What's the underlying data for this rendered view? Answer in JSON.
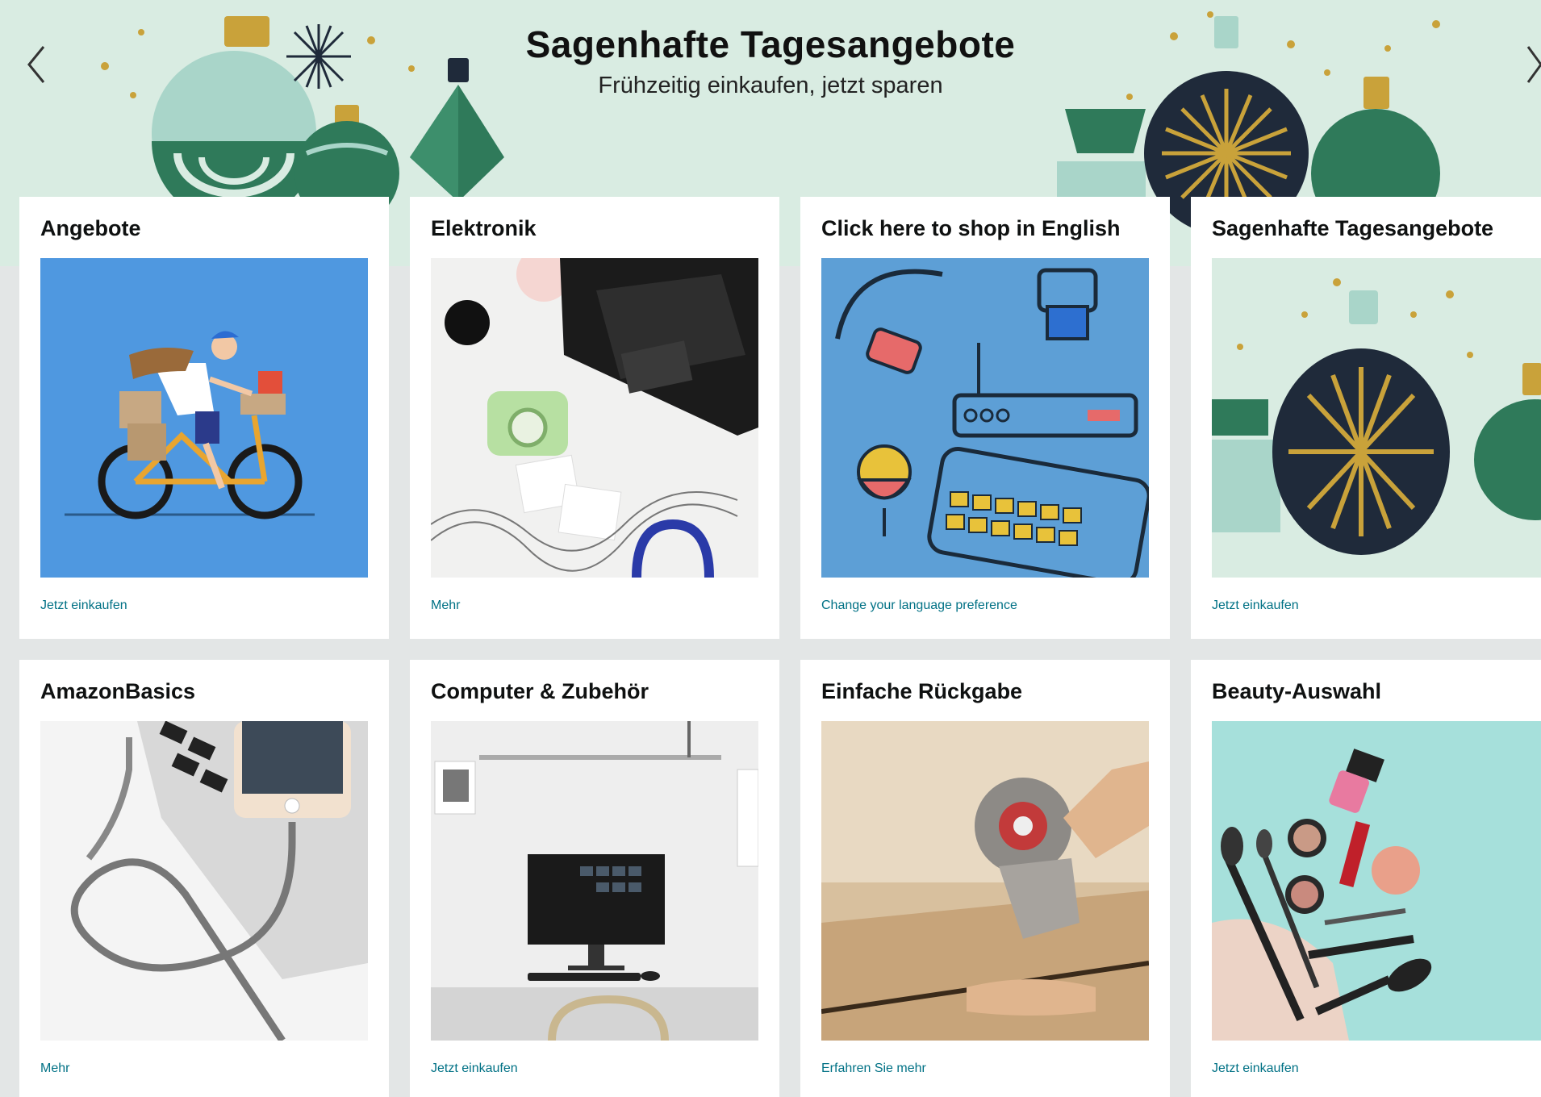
{
  "hero": {
    "title": "Sagenhafte Tagesangebote",
    "subtitle": "Frühzeitig einkaufen, jetzt sparen",
    "prev_icon": "chevron-left-icon",
    "next_icon": "chevron-right-icon"
  },
  "cards": [
    {
      "title": "Angebote",
      "link": "Jetzt einkaufen",
      "image": "cyclist-delivery-illustration"
    },
    {
      "title": "Elektronik",
      "link": "Mehr",
      "image": "laptop-camera-headphones-flatlay"
    },
    {
      "title": "Click here to shop in English",
      "link": "Change your language preference",
      "image": "electronics-illustration"
    },
    {
      "title": "Sagenhafte Tagesangebote",
      "link": "Jetzt einkaufen",
      "image": "christmas-ornaments"
    },
    {
      "title": "AmazonBasics",
      "link": "Mehr",
      "image": "phone-charging-cable"
    },
    {
      "title": "Computer & Zubehör",
      "link": "Jetzt einkaufen",
      "image": "all-in-one-desktop"
    },
    {
      "title": "Einfache Rückgabe",
      "link": "Erfahren Sie mehr",
      "image": "tape-dispenser-box"
    },
    {
      "title": "Beauty-Auswahl",
      "link": "Jetzt einkaufen",
      "image": "makeup-brushes-flatlay"
    }
  ],
  "colors": {
    "link": "#007185",
    "hero_bg": "#d9ece2",
    "page_bg": "#e3e6e6"
  }
}
